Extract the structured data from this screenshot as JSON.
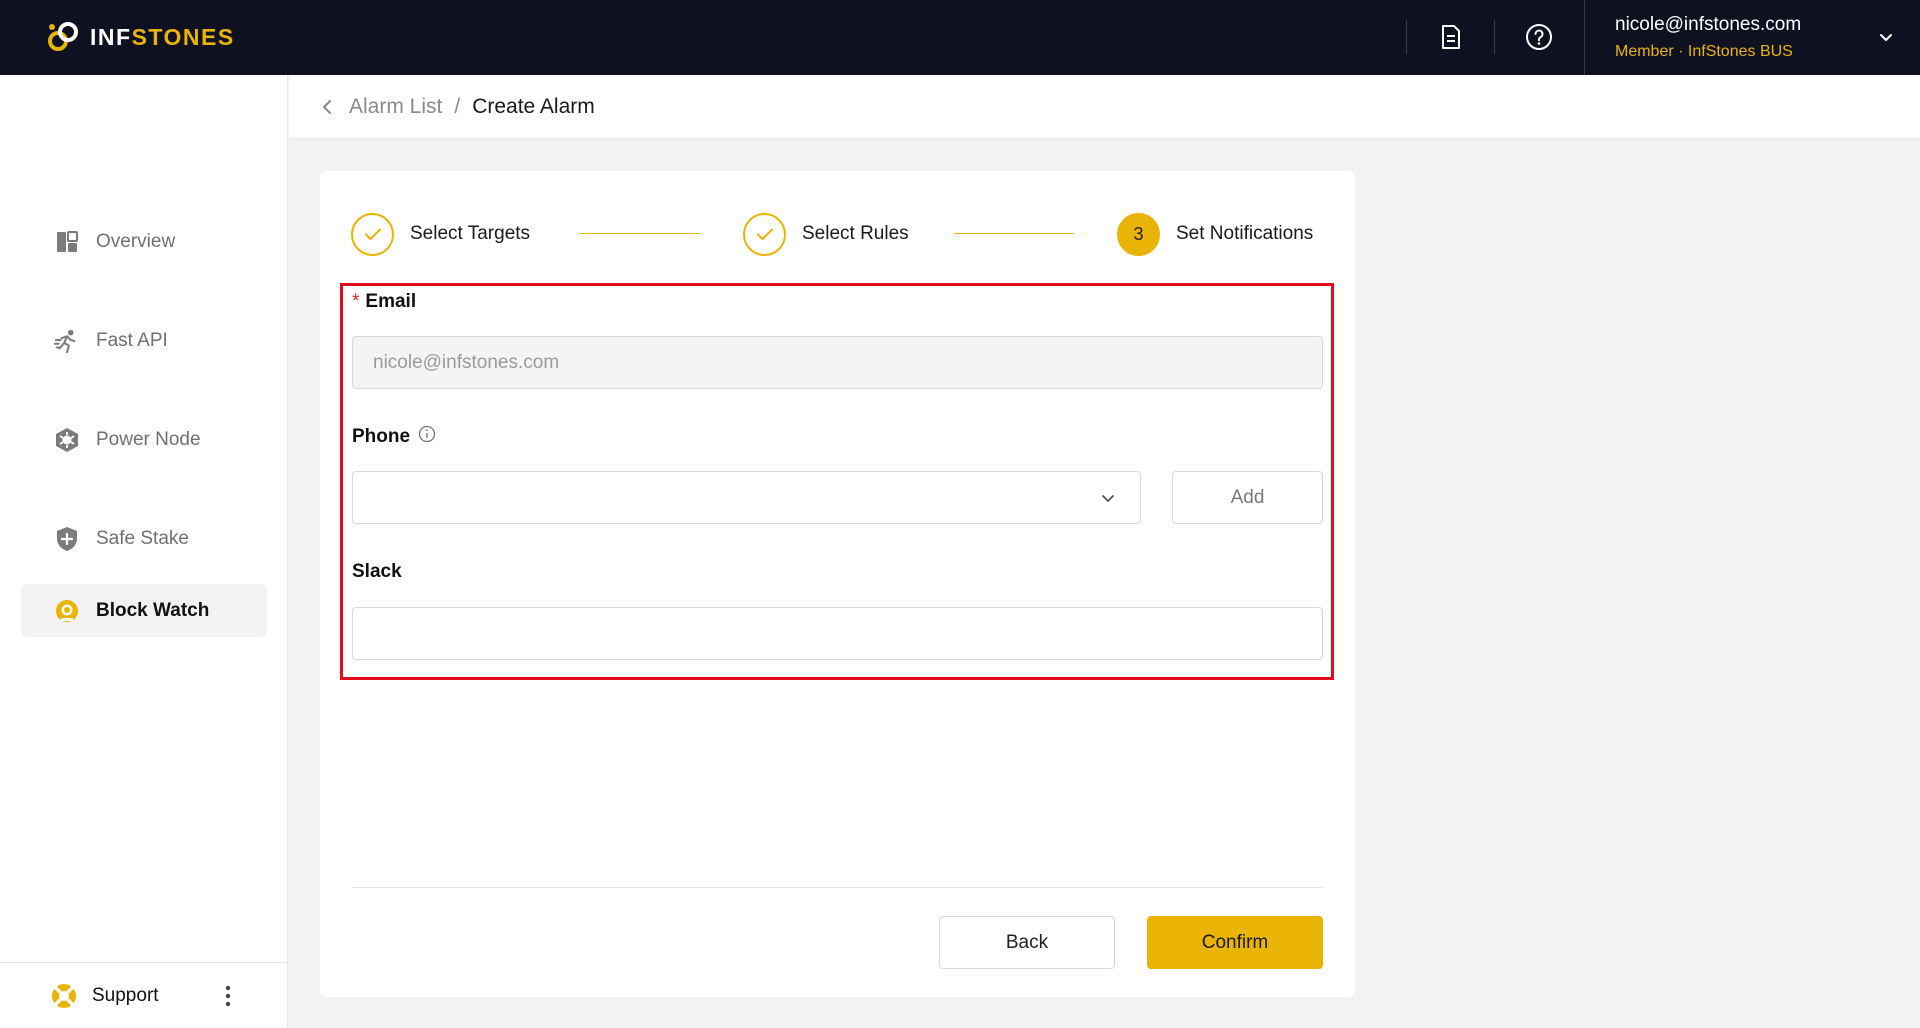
{
  "brand": {
    "name_left": "INF",
    "name_right": "STONES",
    "accent": "#e9b405",
    "topbar_bg": "#0f1120"
  },
  "topbar": {
    "doc_icon": "document-icon",
    "help_icon": "help-circle-icon",
    "user_email": "nicole@infstones.com",
    "user_role": "Member · InfStones BUS"
  },
  "sidebar": {
    "items": [
      {
        "label": "Overview",
        "icon": "overview-icon",
        "active": false
      },
      {
        "label": "Fast API",
        "icon": "running-icon",
        "active": false
      },
      {
        "label": "Power Node",
        "icon": "hexagon-node-icon",
        "active": false
      },
      {
        "label": "Safe Stake",
        "icon": "shield-plus-icon",
        "active": false
      },
      {
        "label": "Block Watch",
        "icon": "block-watch-icon",
        "active": true
      }
    ],
    "support_label": "Support"
  },
  "breadcrumb": {
    "parent": "Alarm List",
    "separator": "/",
    "current": "Create Alarm"
  },
  "steps": [
    {
      "label": "Select Targets",
      "state": "done"
    },
    {
      "label": "Select Rules",
      "state": "done"
    },
    {
      "label": "Set Notifications",
      "state": "current",
      "number": "3"
    }
  ],
  "form": {
    "email": {
      "label": "Email",
      "required_mark": "*",
      "value": "nicole@infstones.com"
    },
    "phone": {
      "label": "Phone",
      "value": "",
      "add_label": "Add"
    },
    "slack": {
      "label": "Slack",
      "value": ""
    }
  },
  "footer": {
    "back_label": "Back",
    "confirm_label": "Confirm"
  }
}
